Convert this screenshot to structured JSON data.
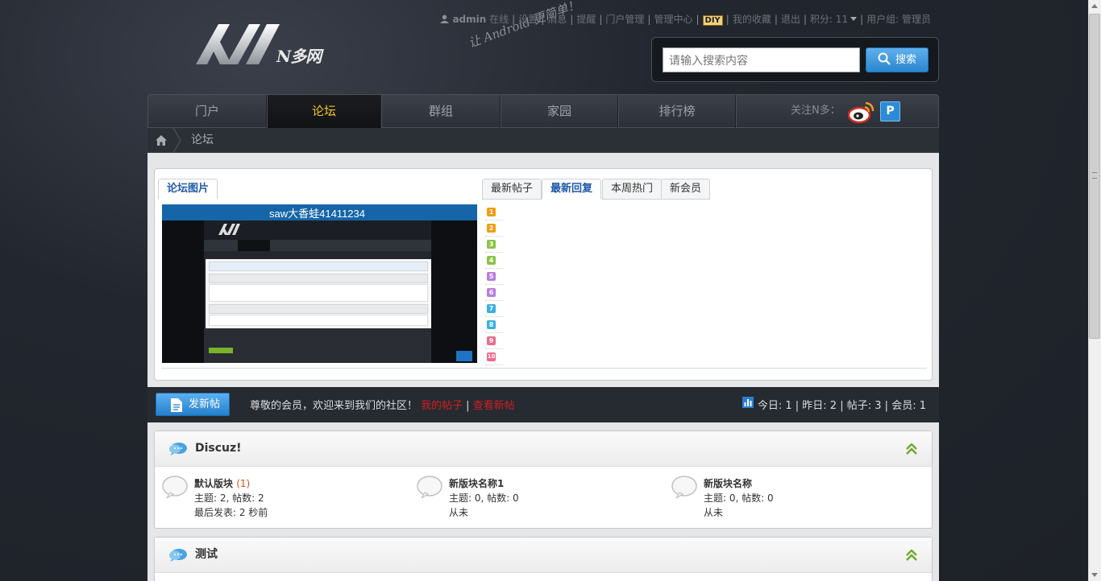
{
  "header": {
    "logo_text": "N多网",
    "slogan": "让 Android 更简单！",
    "toolbar": {
      "username": "admin",
      "online": "在线",
      "settings": "设置",
      "messages": "消息",
      "reminders": "提醒",
      "portal_admin": "门户管理",
      "admin_center": "管理中心",
      "diy": "DIY",
      "favorites": "我的收藏",
      "logout": "退出",
      "points": "积分: 11",
      "user_group": "用户组: 管理员"
    },
    "search": {
      "placeholder": "请输入搜索内容",
      "button": "搜索"
    }
  },
  "nav": {
    "items": [
      "门户",
      "论坛",
      "群组",
      "家园",
      "排行榜"
    ],
    "active": "论坛",
    "follow_label": "关注N多："
  },
  "breadcrumb": {
    "current": "论坛"
  },
  "portal": {
    "tab_left": "论坛图片",
    "tabs": [
      "最新帖子",
      "最新回复",
      "本周热门",
      "新会员"
    ],
    "active_tab": "最新回复",
    "image_caption": "saw大香蛙41411234",
    "rank_numbers": [
      "1",
      "2",
      "3",
      "4",
      "5",
      "6",
      "7",
      "8",
      "9",
      "10"
    ]
  },
  "postbar": {
    "new_post": "发新帖",
    "welcome": "尊敬的会员，欢迎来到我们的社区！",
    "my_posts": "我的帖子",
    "view_new": "查看新帖",
    "stats": {
      "today": "今日: 1",
      "yesterday": "昨日: 2",
      "posts": "帖子: 3",
      "members": "会员: 1"
    }
  },
  "forums": [
    {
      "title": "Discuz!",
      "boards": [
        {
          "name": "默认版块",
          "count": "(1)",
          "topics": "主题: 2, 帖数: 2",
          "last": "最后发表: 2 秒前"
        },
        {
          "name": "新版块名称1",
          "count": "",
          "topics": "主题: 0, 帖数: 0",
          "last": "从未"
        },
        {
          "name": "新版块名称",
          "count": "",
          "topics": "主题: 0, 帖数: 0",
          "last": "从未"
        }
      ]
    },
    {
      "title": "测试",
      "boards": []
    }
  ],
  "colors": {
    "accent_blue": "#2a86cf",
    "nav_active": "#f4c51f",
    "link_red": "#d11f1f"
  }
}
